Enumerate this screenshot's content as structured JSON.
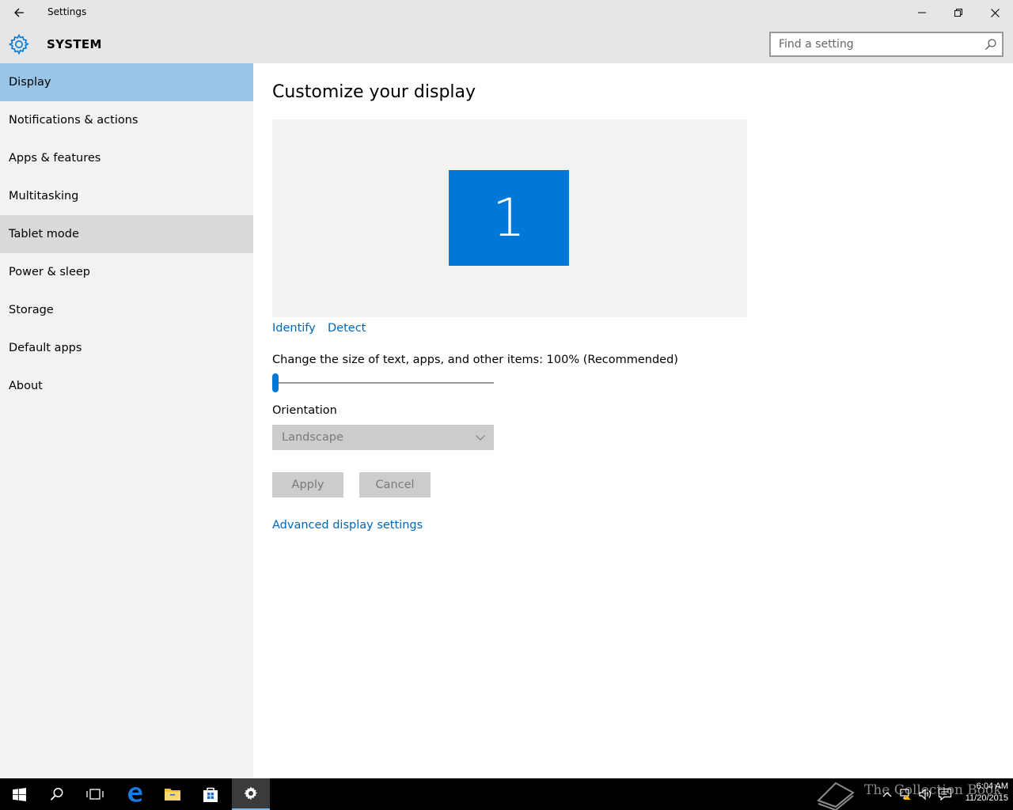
{
  "window": {
    "title": "Settings",
    "back_icon": "back-arrow-icon",
    "controls": [
      "minimize-icon",
      "restore-icon",
      "close-icon"
    ]
  },
  "header": {
    "section_title": "SYSTEM",
    "icon": "gear-icon",
    "search_placeholder": "Find a setting"
  },
  "sidebar": {
    "items": [
      {
        "label": "Display",
        "state": "selected"
      },
      {
        "label": "Notifications & actions",
        "state": "normal"
      },
      {
        "label": "Apps & features",
        "state": "normal"
      },
      {
        "label": "Multitasking",
        "state": "normal"
      },
      {
        "label": "Tablet mode",
        "state": "hover"
      },
      {
        "label": "Power & sleep",
        "state": "normal"
      },
      {
        "label": "Storage",
        "state": "normal"
      },
      {
        "label": "Default apps",
        "state": "normal"
      },
      {
        "label": "About",
        "state": "normal"
      }
    ]
  },
  "main": {
    "title": "Customize your display",
    "monitor_number": "1",
    "identify_label": "Identify",
    "detect_label": "Detect",
    "scale_label": "Change the size of text, apps, and other items: 100% (Recommended)",
    "scale_slider_value": 0,
    "orientation_label": "Orientation",
    "orientation_value": "Landscape",
    "apply_label": "Apply",
    "cancel_label": "Cancel",
    "advanced_label": "Advanced display settings"
  },
  "taskbar": {
    "apps": [
      "windows-start-icon",
      "search-icon",
      "task-view-icon",
      "edge-icon",
      "file-explorer-icon",
      "store-icon",
      "settings-icon"
    ],
    "active_app": "settings-icon",
    "watermark": "The Collection Book",
    "time": "6:04 AM",
    "date": "11/20/2015"
  },
  "colors": {
    "accent": "#0078d7",
    "nav_selected": "#99c5e9",
    "link": "#0067b8",
    "taskbar": "#000000"
  }
}
